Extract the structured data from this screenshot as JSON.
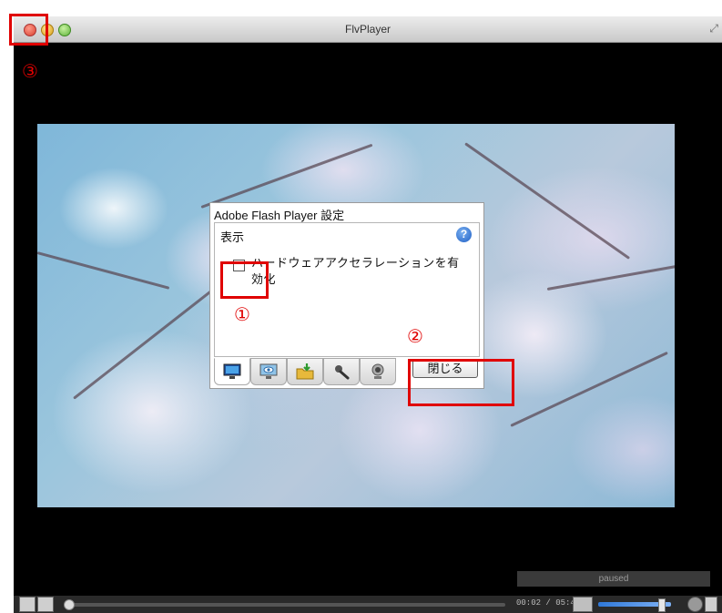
{
  "window": {
    "title": "FlvPlayer"
  },
  "dialog": {
    "title": "Adobe Flash Player 設定",
    "section": "表示",
    "checkbox_label": "ハードウェアアクセラレーションを有効化",
    "checked": false,
    "tabs": [
      {
        "name": "display",
        "icon": "monitor-icon",
        "selected": true
      },
      {
        "name": "privacy",
        "icon": "eye-monitor-icon",
        "selected": false
      },
      {
        "name": "storage",
        "icon": "folder-download-icon",
        "selected": false
      },
      {
        "name": "microphone",
        "icon": "microphone-icon",
        "selected": false
      },
      {
        "name": "camera",
        "icon": "webcam-icon",
        "selected": false
      }
    ],
    "close_button": "閉じる"
  },
  "annotations": {
    "one": "①",
    "two": "②",
    "three": "③"
  },
  "player": {
    "status": "paused",
    "time": "00:02 / 05:48"
  },
  "colors": {
    "annotation_red": "#e00000",
    "help_blue": "#1f5fc5"
  }
}
